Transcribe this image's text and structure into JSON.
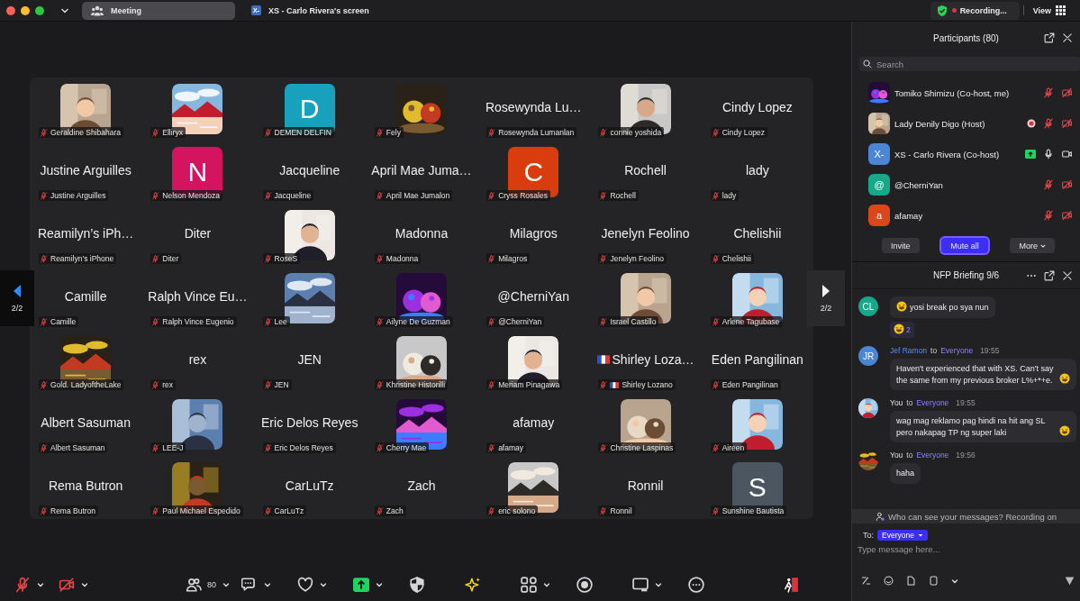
{
  "top_bar": {
    "tabs": [
      {
        "label": "Meeting",
        "selected": true,
        "kind": "people"
      },
      {
        "label": "XS - Carlo Rivera's screen",
        "selected": false,
        "kind": "badge",
        "badge": "X-"
      }
    ],
    "recording": "Recording...",
    "view": "View"
  },
  "pagers": {
    "left": {
      "label": "2/2",
      "highlighted": true
    },
    "right": {
      "label": "2/2",
      "highlighted": false
    }
  },
  "tiles": [
    {
      "name": "Geraldine Shibahara"
    },
    {
      "name": "Elliryx"
    },
    {
      "kind": "letter",
      "letter": "D",
      "color": "#17a1bd",
      "name": "DEMEN DELFIN"
    },
    {
      "name": "Fely"
    },
    {
      "kind": "text",
      "display": "Rosewynda Lu…",
      "name": "Rosewynda Lumanlan"
    },
    {
      "name": "connie yoshida"
    },
    {
      "kind": "text",
      "display": "Cindy Lopez",
      "name": "Cindy Lopez"
    },
    {
      "kind": "text",
      "display": "Justine Arguilles",
      "name": "Justine Arguilles"
    },
    {
      "kind": "letter",
      "letter": "N",
      "color": "#d4145f",
      "name": "Nelson Mendoza"
    },
    {
      "kind": "text",
      "display": "Jacqueline",
      "name": "Jacqueline"
    },
    {
      "kind": "text",
      "display": "April Mae Juma…",
      "name": "April Mae Jumalon"
    },
    {
      "kind": "letter",
      "letter": "C",
      "color": "#d93d0d",
      "name": "Cryss Rosales"
    },
    {
      "kind": "text",
      "display": "Rochell",
      "name": "Rochell"
    },
    {
      "kind": "text",
      "display": "lady",
      "name": "lady"
    },
    {
      "kind": "text",
      "display": "Reamilyn’s iPh…",
      "name": "Reamilyn’s iPhone"
    },
    {
      "kind": "text",
      "display": "Diter",
      "name": "Diter"
    },
    {
      "name": "RoseS"
    },
    {
      "kind": "text",
      "display": "Madonna",
      "name": "Madonna"
    },
    {
      "kind": "text",
      "display": "Milagros",
      "name": "Milagros"
    },
    {
      "kind": "text",
      "display": "Jenelyn Feolino",
      "name": "Jenelyn Feolino"
    },
    {
      "kind": "text",
      "display": "Chelishii",
      "name": "Chelishii"
    },
    {
      "kind": "text",
      "display": "Camille",
      "name": "Camille"
    },
    {
      "kind": "text",
      "display": "Ralph Vince Eu…",
      "name": "Ralph Vince Eugenio"
    },
    {
      "name": "Lee"
    },
    {
      "name": "Ailyne De Guzman"
    },
    {
      "kind": "text",
      "display": "@CherniYan",
      "name": "@CherniYan"
    },
    {
      "name": "Israel Castillo"
    },
    {
      "name": "Arlene Tagubase"
    },
    {
      "name": "Gold. LadyoftheLake"
    },
    {
      "kind": "text",
      "display": "rex",
      "name": "rex"
    },
    {
      "kind": "text",
      "display": "JEN",
      "name": "JEN"
    },
    {
      "name": "Khristine Historilli"
    },
    {
      "name": "Meriam Pinagawa"
    },
    {
      "kind": "text",
      "display": "Shirley Loza…",
      "name": "Shirley Lozano",
      "flag": true
    },
    {
      "kind": "text",
      "display": "Eden Pangilinan",
      "name": "Eden Pangilinan"
    },
    {
      "kind": "text",
      "display": "Albert Sasuman",
      "name": "Albert Sasuman"
    },
    {
      "name": "LEE-J"
    },
    {
      "kind": "text",
      "display": "Eric Delos Reyes",
      "name": "Eric Delos Reyes"
    },
    {
      "name": "Cherry Mae"
    },
    {
      "kind": "text",
      "display": "afamay",
      "name": "afamay"
    },
    {
      "name": "Christine Laspinas"
    },
    {
      "name": "Aireen"
    },
    {
      "kind": "text",
      "display": "Rema Butron",
      "name": "Rema Butron"
    },
    {
      "name": "Paul Michael Espedido"
    },
    {
      "kind": "text",
      "display": "CarLuTz",
      "name": "CarLuTz"
    },
    {
      "kind": "text",
      "display": "Zach",
      "name": "Zach"
    },
    {
      "name": "eric solono"
    },
    {
      "kind": "text",
      "display": "Ronnil",
      "name": "Ronnil"
    },
    {
      "kind": "letter",
      "letter": "S",
      "color": "#4b5661",
      "name": "Sunshine Bautista"
    }
  ],
  "toolbar": [
    {
      "kind": "audio",
      "muted": true,
      "caret": true
    },
    {
      "kind": "video",
      "muted": true,
      "caret": true
    },
    {
      "kind": "participants",
      "count": "80",
      "caret": true
    },
    {
      "kind": "chat",
      "caret": true
    },
    {
      "kind": "react",
      "caret": true
    },
    {
      "kind": "share",
      "caret": true
    },
    {
      "kind": "security",
      "caret": false
    },
    {
      "kind": "ai",
      "caret": false
    },
    {
      "kind": "apps",
      "caret": true
    },
    {
      "kind": "record",
      "caret": false
    },
    {
      "kind": "whiteboard",
      "caret": true
    },
    {
      "kind": "more",
      "caret": false
    },
    {
      "kind": "leave",
      "caret": false
    }
  ],
  "participants": {
    "title": "Participants (80)",
    "search": {
      "placeholder": "Search"
    },
    "rows": [
      {
        "name": "Tomiko Shimizu (Co-host, me)",
        "recording": false,
        "sharing": false,
        "muted": true,
        "video_off": true
      },
      {
        "name": "Lady Denily Digo (Host)",
        "recording": true,
        "sharing": false,
        "muted": true,
        "video_off": true
      },
      {
        "avatar": {
          "kind": "letter",
          "text": "X-",
          "color": "#4a86d4"
        },
        "name": "XS - Carlo Rivera (Co-host)",
        "recording": false,
        "sharing": true,
        "muted": false,
        "video_off": false
      },
      {
        "avatar": {
          "kind": "letter",
          "text": "@",
          "color": "#17a88a"
        },
        "name": "@CherniYan",
        "recording": false,
        "sharing": false,
        "muted": true,
        "video_off": true
      },
      {
        "avatar": {
          "kind": "letter",
          "text": "a",
          "color": "#d9481a"
        },
        "name": "afamay",
        "recording": false,
        "sharing": false,
        "muted": true,
        "video_off": true
      }
    ],
    "buttons": [
      {
        "label": "Invite",
        "primary": false,
        "caret": false
      },
      {
        "label": "Mute all",
        "primary": true,
        "caret": false
      },
      {
        "label": "More",
        "primary": false,
        "caret": true
      }
    ]
  },
  "chat": {
    "title": "NFP Briefing 9/6",
    "messages": [
      {
        "avatar": {
          "kind": "letter",
          "text": "CL",
          "color": "#17a88a"
        },
        "text": "yosi break po sya nun",
        "leading_emoji": true,
        "trailing_emoji": false,
        "reaction": "2"
      },
      {
        "avatar": {
          "kind": "letter",
          "text": "JR",
          "color": "#4a86d4"
        },
        "sender": "Jef Ramon",
        "self": false,
        "to": "to",
        "recipient": "Everyone",
        "time": "19:55",
        "text": "Haven't experienced that with XS. Can't say the same from my previous broker L%+*+e.",
        "leading_emoji": false,
        "trailing_emoji": true
      },
      {
        "sender": "You",
        "self": true,
        "to": "to",
        "recipient": "Everyone",
        "time": "19:55",
        "text": "wag mag reklamo pag hindi na hit ang SL pero nakapag TP ng super laki",
        "leading_emoji": false,
        "trailing_emoji": true
      },
      {
        "sender": "You",
        "self": true,
        "to": "to",
        "recipient": "Everyone",
        "time": "19:56",
        "text": "haha",
        "leading_emoji": false,
        "trailing_emoji": false
      }
    ],
    "notice": "Who can see your messages? Recording on",
    "to_label": "To:",
    "recipient": "Everyone",
    "input": {
      "placeholder": "Type message here..."
    }
  }
}
